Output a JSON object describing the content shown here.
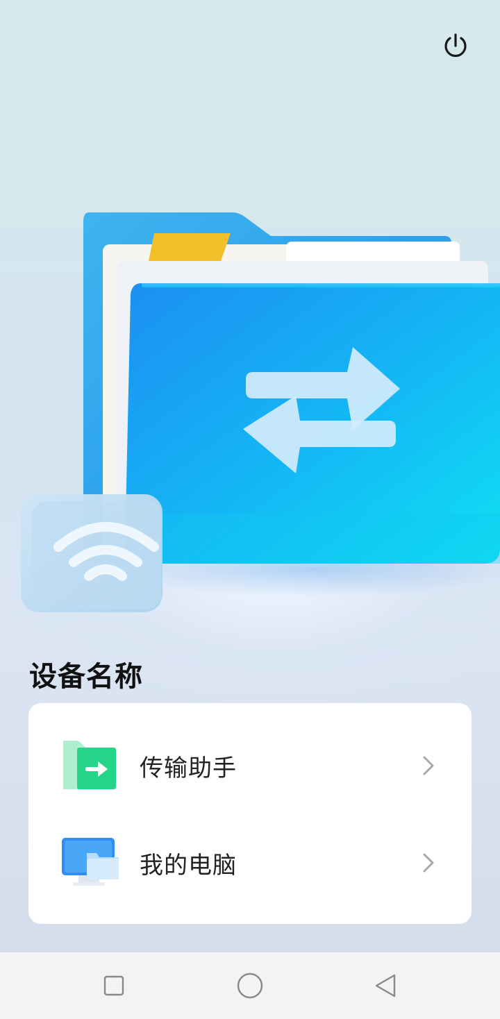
{
  "header": {
    "power_icon": "power-icon"
  },
  "hero": {
    "illustration": "file-transfer-folder-illustration"
  },
  "section": {
    "title": "设备名称"
  },
  "list": {
    "items": [
      {
        "label": "传输助手",
        "icon": "transfer-assistant-icon"
      },
      {
        "label": "我的电脑",
        "icon": "my-computer-icon"
      }
    ]
  },
  "navbar": {
    "buttons": [
      "recents-square-icon",
      "home-circle-icon",
      "back-triangle-icon"
    ]
  },
  "colors": {
    "accent_blue": "#1a9cf0",
    "accent_green": "#2bd48a",
    "card_bg": "#ffffff"
  }
}
